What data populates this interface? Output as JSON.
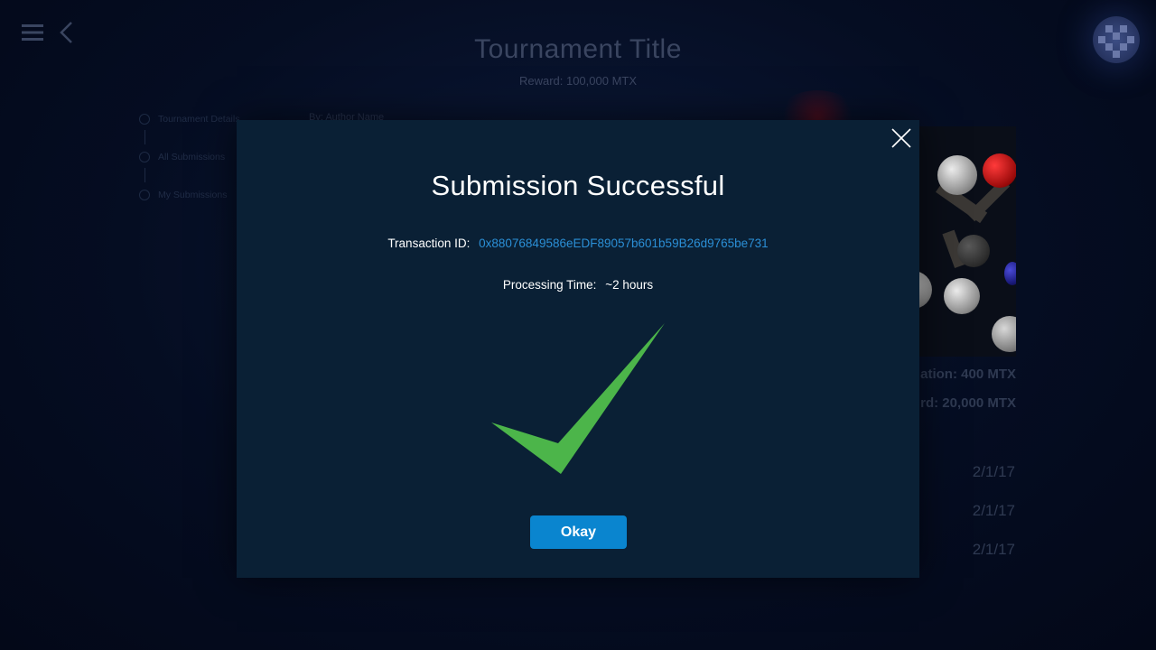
{
  "background": {
    "title": "Tournament Title",
    "reward": "Reward: 100,000 MTX",
    "author": "By: Author Name",
    "steps": [
      {
        "label": "Tournament Details"
      },
      {
        "label": "All Submissions"
      },
      {
        "label": "My Submissions"
      }
    ],
    "stats": [
      {
        "text": "ation: 400 MTX"
      },
      {
        "text": "rd: 20,000 MTX"
      }
    ],
    "dates": [
      "2/1/17",
      "2/1/17",
      "2/1/17"
    ]
  },
  "modal": {
    "title": "Submission Successful",
    "transaction_label": "Transaction ID:",
    "transaction_id": "0x88076849586eEDF89057b601b59B26d9765be731",
    "processing_label": "Processing Time:",
    "processing_value": "~2 hours",
    "okay_label": "Okay"
  },
  "icons": {
    "menu": "hamburger-icon",
    "back": "chevron-left-icon",
    "close": "close-icon",
    "success": "checkmark-icon",
    "avatar": "avatar"
  },
  "colors": {
    "modal_bg": "#0a2035",
    "accent": "#0a85cf",
    "link": "#2b8fd6",
    "success": "#4cb54a"
  }
}
